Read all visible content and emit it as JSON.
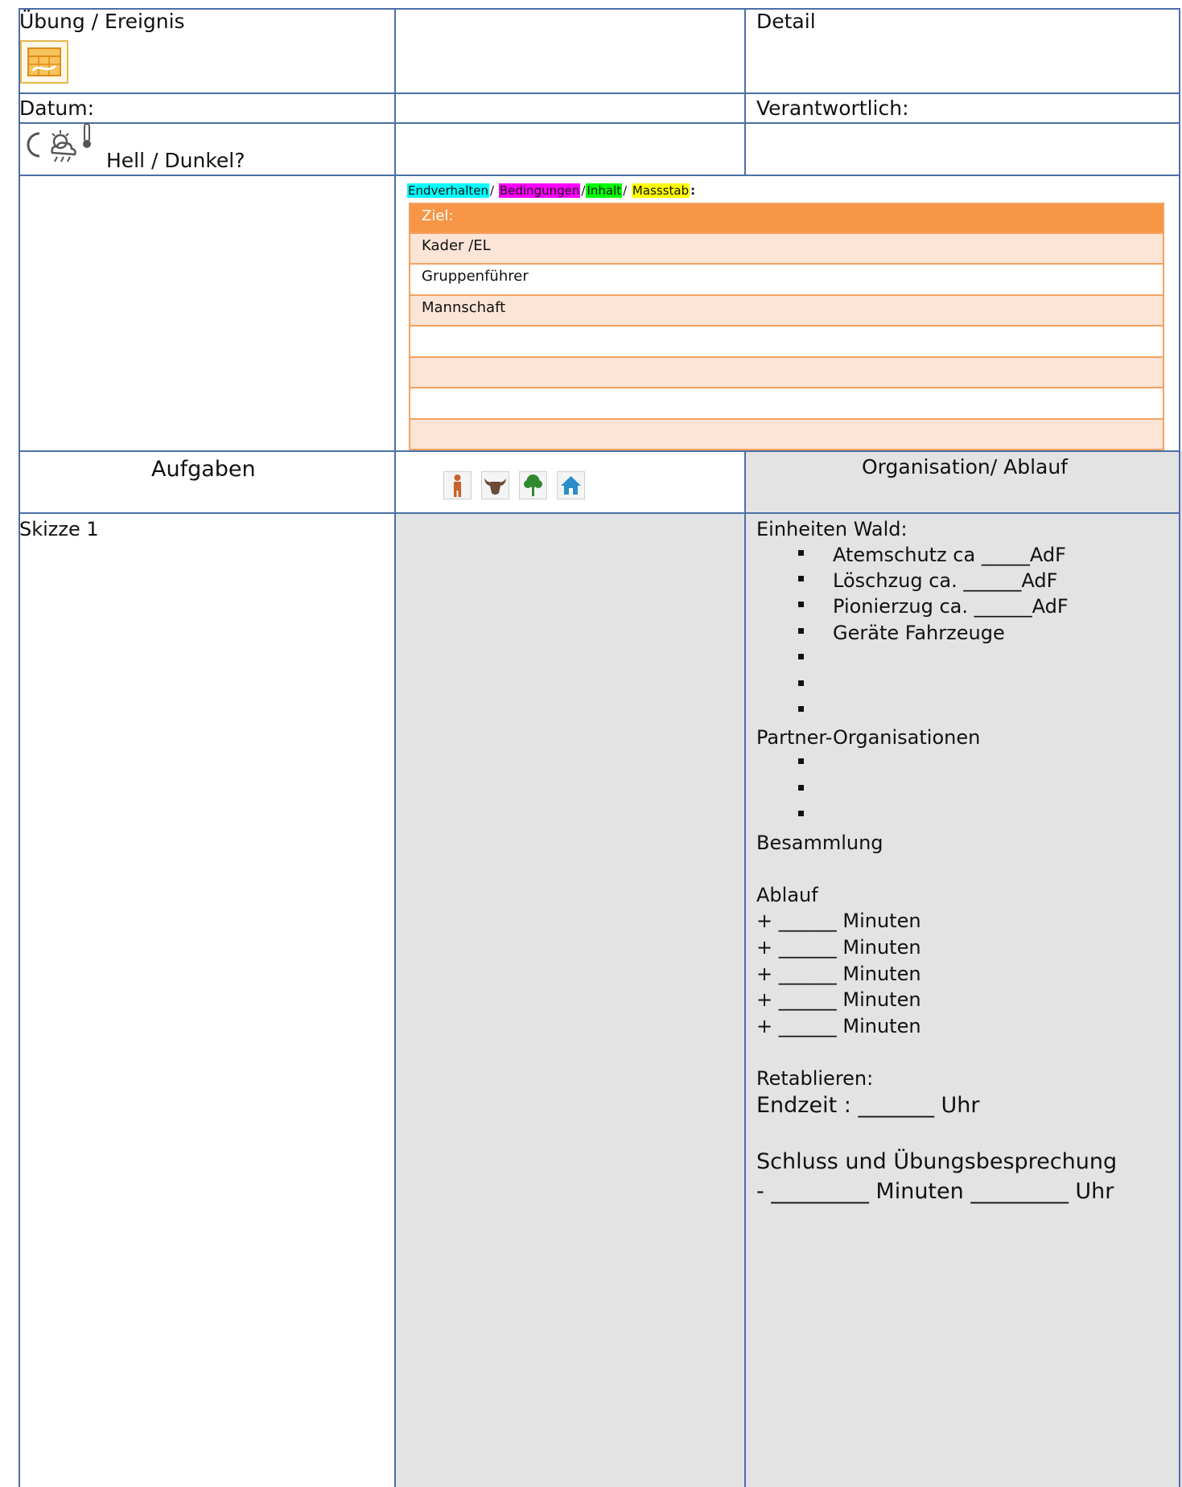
{
  "header": {
    "title_clipped": "",
    "exercise_label": "Übung / Ereignis",
    "detail_label": "Detail",
    "date_label": "Datum:",
    "responsible_label": "Verantwortlich:",
    "light_label": "Hell / Dunkel?"
  },
  "goals": {
    "key": {
      "endverhalten": "Endverhalten",
      "sep1": "/ ",
      "bedingungen": "Bedingungen",
      "sep2": "/",
      "inhalt": "Inhalt",
      "sep3": "/ ",
      "massstab": "Massstab",
      "colon": ":"
    },
    "rows": [
      "Ziel:",
      "Kader /EL",
      "Gruppenführer",
      "Mannschaft",
      "",
      "",
      "",
      ""
    ],
    "colors": {
      "header": "#f79646",
      "light": "#fce4d6",
      "cyan": "#00ffff",
      "magenta": "#ff00ff",
      "green": "#00ff00",
      "yellow": "#ffff00"
    }
  },
  "section": {
    "tasks_label": "Aufgaben",
    "org_label": "Organisation/ Ablauf",
    "sketch_label": "Skizze 1",
    "icons": [
      "person-icon",
      "cattle-icon",
      "tree-icon",
      "house-icon"
    ]
  },
  "organisation": {
    "units_title": "Einheiten Wald:",
    "units": [
      "Atemschutz  ca _____AdF",
      "Löschzug ca. ______AdF",
      "Pionierzug ca. ______AdF",
      "Geräte Fahrzeuge",
      "",
      "",
      ""
    ],
    "partners_title": "Partner-Organisationen",
    "partners": [
      "",
      "",
      ""
    ],
    "assembly": "Besammlung",
    "schedule_title": "Ablauf",
    "schedule": [
      "+ ______ Minuten",
      "+ ______ Minuten",
      "+ ______ Minuten",
      "+ ______ Minuten",
      "+ ______ Minuten"
    ],
    "retablieren": "Retablieren:",
    "endzeit": "Endzeit : _______ Uhr",
    "closing": "Schluss und Übungsbesprechung",
    "closing_line": "- _________ Minuten _________ Uhr"
  }
}
